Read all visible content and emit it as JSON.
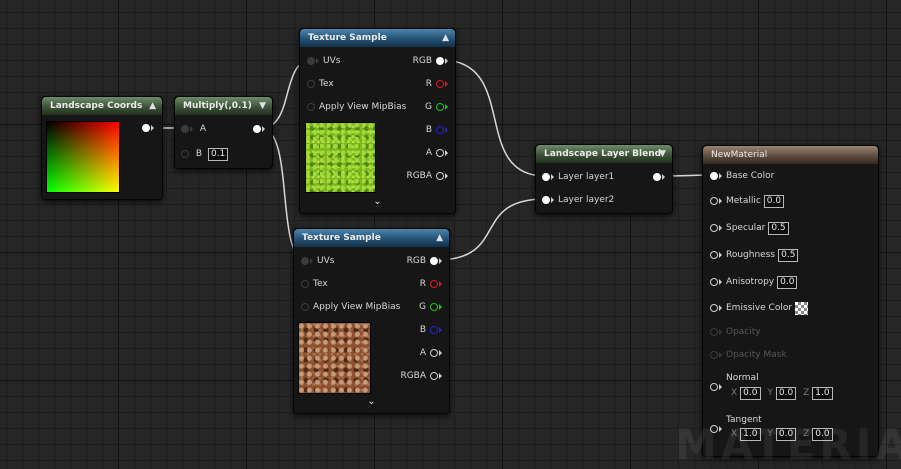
{
  "nodes": {
    "landscape_coords": {
      "title": "Landscape Coords"
    },
    "multiply": {
      "title": "Multiply(,0.1)",
      "pin_a": "A",
      "pin_b": "B",
      "b_value": "0.1"
    },
    "texture_sample_1": {
      "title": "Texture Sample",
      "inputs": [
        "UVs",
        "Tex",
        "Apply View MipBias"
      ],
      "outputs": [
        "RGB",
        "R",
        "G",
        "B",
        "A",
        "RGBA"
      ],
      "preview": "grass"
    },
    "texture_sample_2": {
      "title": "Texture Sample",
      "inputs": [
        "UVs",
        "Tex",
        "Apply View MipBias"
      ],
      "outputs": [
        "RGB",
        "R",
        "G",
        "B",
        "A",
        "RGBA"
      ],
      "preview": "dirt"
    },
    "layer_blend": {
      "title": "Landscape Layer Blend",
      "inputs": [
        "Layer layer1",
        "Layer layer2"
      ]
    },
    "material": {
      "title": "NewMaterial",
      "base_color": "Base Color",
      "metallic": {
        "label": "Metallic",
        "value": "0.0"
      },
      "specular": {
        "label": "Specular",
        "value": "0.5"
      },
      "roughness": {
        "label": "Roughness",
        "value": "0.5"
      },
      "anisotropy": {
        "label": "Anisotropy",
        "value": "0.0"
      },
      "emissive": "Emissive Color",
      "opacity": "Opacity",
      "opacity_mask": "Opacity Mask",
      "normal": {
        "label": "Normal",
        "x": "0.0",
        "y": "0.0",
        "z": "1.0"
      },
      "tangent": {
        "label": "Tangent",
        "x": "1.0",
        "y": "0.0",
        "z": "0.0"
      }
    }
  },
  "axes": {
    "x": "X",
    "y": "Y",
    "z": "Z"
  },
  "watermark": "MATERIAL",
  "colors": {
    "wire": "#d8d8d8",
    "red_pin": "#e01818",
    "green_pin": "#18c818",
    "blue_pin": "#2222d8"
  }
}
